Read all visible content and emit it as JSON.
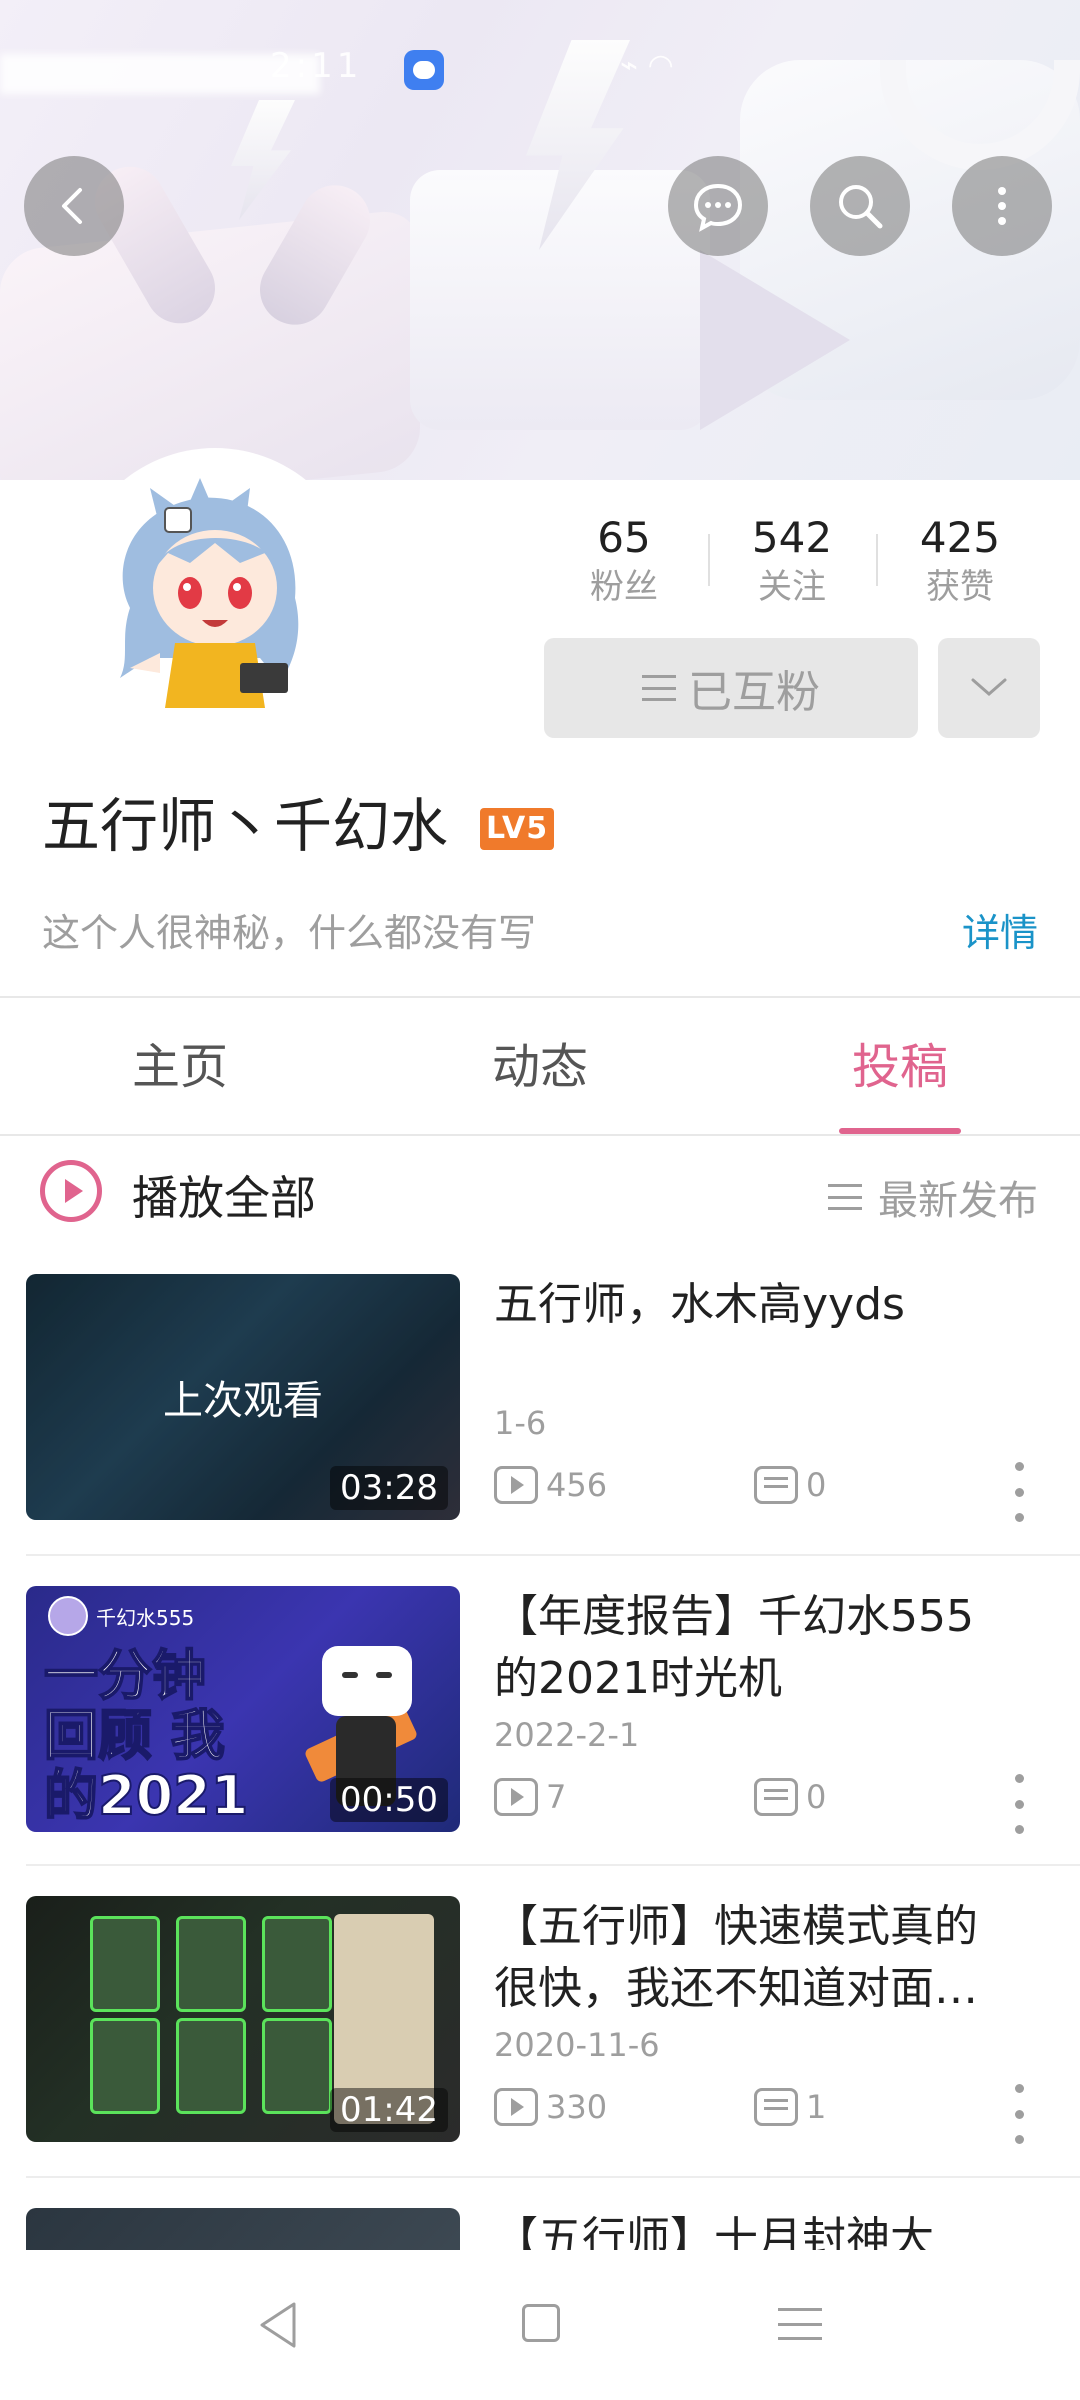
{
  "status_bar": {
    "time": "2:11",
    "network": "⌁ ◠"
  },
  "profile": {
    "stats": [
      {
        "value": "65",
        "label": "粉丝"
      },
      {
        "value": "542",
        "label": "关注"
      },
      {
        "value": "425",
        "label": "获赞"
      }
    ],
    "follow_label": "已互粉",
    "username": "五行师丶千幻水",
    "level": "LV5",
    "bio": "这个人很神秘，什么都没有写",
    "details_label": "详情"
  },
  "tabs": [
    {
      "label": "主页"
    },
    {
      "label": "动态"
    },
    {
      "label": "投稿"
    }
  ],
  "active_tab": "投稿",
  "accent_color": "#e0648e",
  "list_header": {
    "play_all": "播放全部",
    "sort": "最新发布"
  },
  "videos": [
    {
      "title": "五行师，水木高yyds",
      "date": "1-6",
      "views": "456",
      "comments": "0",
      "duration": "03:28",
      "overlay": "上次观看"
    },
    {
      "title": "【年度报告】千幻水555的2021时光机",
      "date": "2022-2-1",
      "views": "7",
      "comments": "0",
      "duration": "00:50",
      "thumb_channel": "千幻水555",
      "thumb_text": "一分钟 回顾 我的2021"
    },
    {
      "title": "【五行师】快速模式真的很快，我还不知道对面…",
      "date": "2020-11-6",
      "views": "330",
      "comments": "1",
      "duration": "01:42"
    },
    {
      "title": "【五行师】十月封神大",
      "date": "",
      "views": "",
      "comments": "",
      "duration": ""
    }
  ]
}
